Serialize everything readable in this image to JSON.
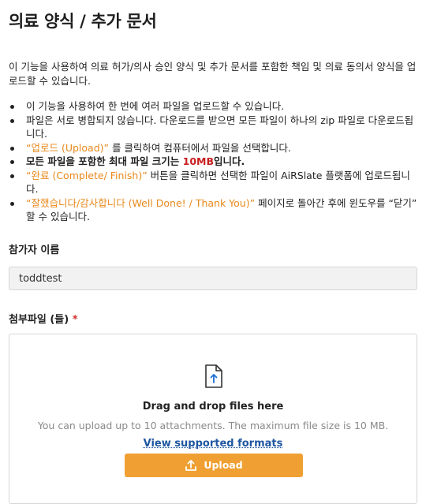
{
  "page": {
    "title": "의료 양식 / 추가 문서",
    "intro": "이 기능을 사용하여 의료 허가/의사 승인 양식 및 추가 문서를 포함한 책임 및 의료 동의서 양식을 업로드할 수 있습니다."
  },
  "rules": {
    "r1": "이 기능을 사용하여 한 번에 여러 파일을 업로드할 수 있습니다.",
    "r2": "파일은 서로 병합되지 않습니다. 다운로드를 받으면 모든 파일이 하나의 zip 파일로 다운로드됩니다.",
    "r3_orange": "“업로드 (Upload)”",
    "r3_rest": " 를 클릭하여 컴퓨터에서 파일을 선택합니다.",
    "r4_before": "모든 파일을 포함한 최대 파일 크기는 ",
    "r4_size": "10MB",
    "r4_after": "입니다.",
    "r5_orange": "“완료 (Complete/ Finish)”",
    "r5_rest": " 버튼을 클릭하면 선택한 파일이 AiRSlate 플랫폼에 업로드됩니다.",
    "r6_orange": "“잘했습니다/감사합니다 (Well Done! / Thank You)”",
    "r6_rest": " 페이지로 돌아간 후에 윈도우를 “닫기” 할 수 있습니다."
  },
  "participant": {
    "label": "참가자 이름",
    "value": "toddtest"
  },
  "attachments": {
    "label": "첨부파일 (들)",
    "required_mark": "*",
    "dropzone_title": "Drag and drop files here",
    "dropzone_subtitle": "You can upload up to 10 attachments.  The maximum file size is 10 MB.",
    "formats_link": "View supported formats",
    "upload_label": "Upload",
    "upload_icon": "upload-icon",
    "file_icon": "file-upload-icon"
  },
  "colors": {
    "accent_orange": "#f0a033",
    "emphasis_orange": "#e8891c",
    "emphasis_red": "#c81e1e",
    "link_blue": "#1e56a0",
    "required_red": "#d0312d"
  }
}
